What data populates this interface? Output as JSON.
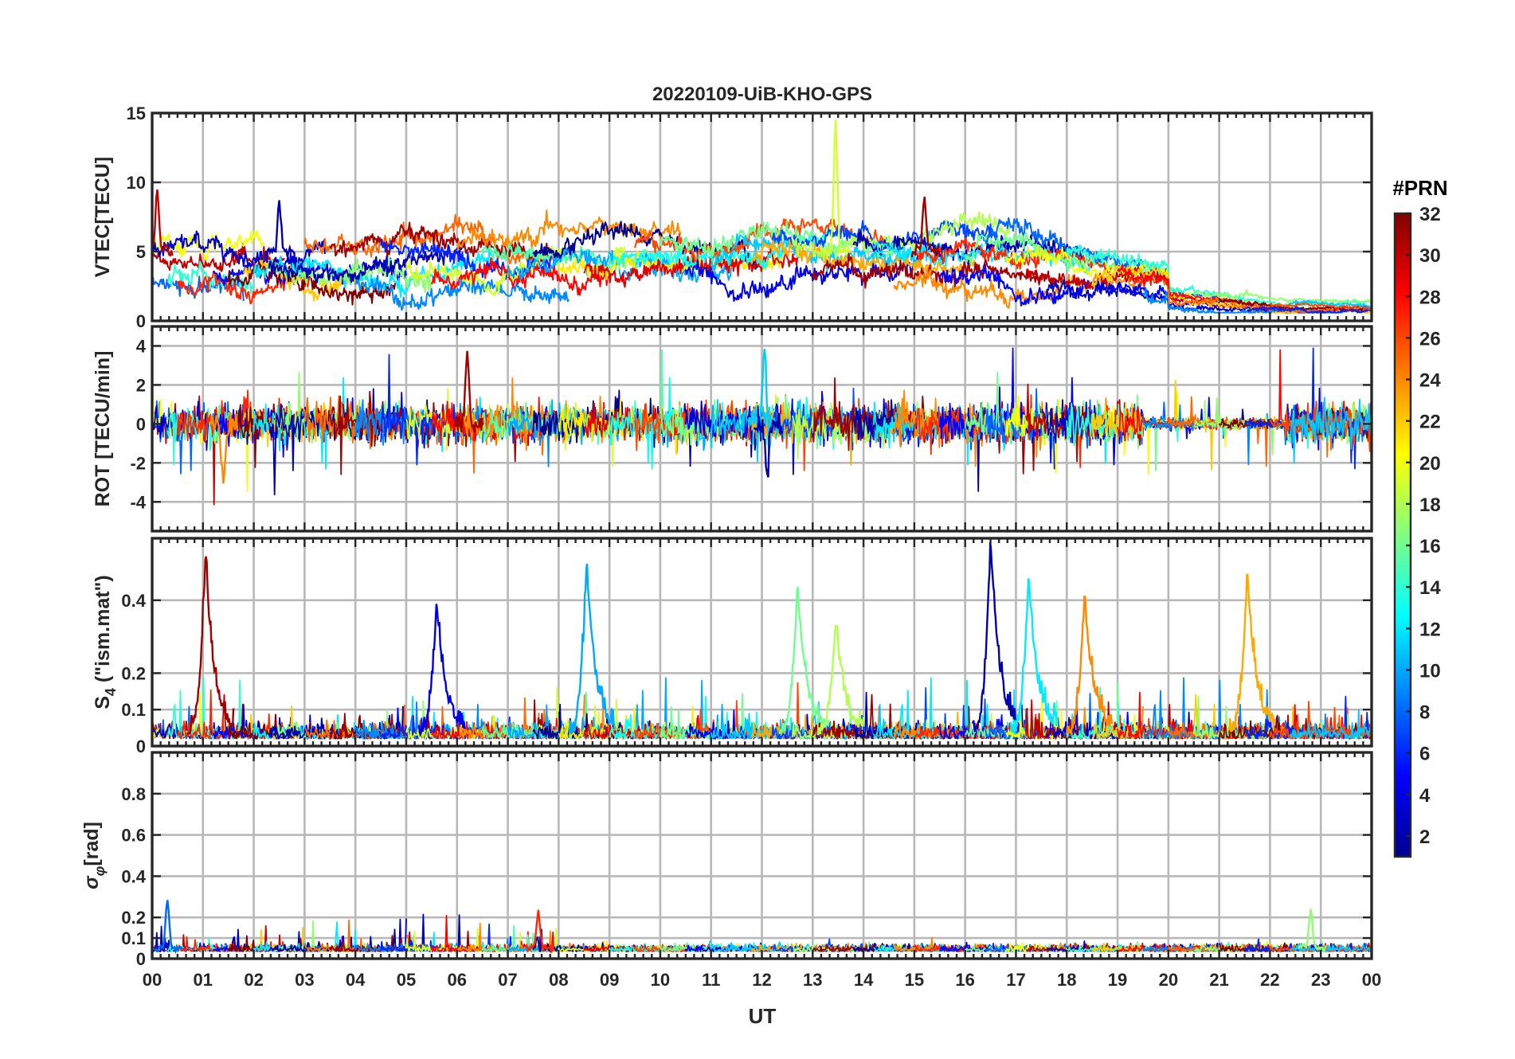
{
  "figure": {
    "title": "20220109-UiB-KHO-GPS",
    "xlabel": "UT"
  },
  "colorbar": {
    "title": "#PRN",
    "ticks": [
      "2",
      "4",
      "6",
      "8",
      "10",
      "12",
      "14",
      "16",
      "18",
      "20",
      "22",
      "24",
      "26",
      "28",
      "30",
      "32"
    ],
    "range": [
      1,
      32
    ],
    "colormap": "jet",
    "colors": [
      "#00008f",
      "#0000ff",
      "#0080ff",
      "#00ffff",
      "#80ff80",
      "#ffff00",
      "#ff8000",
      "#ff0000",
      "#800000"
    ]
  },
  "chart_data": [
    {
      "type": "line",
      "panel": "vtec",
      "ylabel": "VTEC[TECU]",
      "ylim": [
        0,
        15
      ],
      "yticks": [
        "0",
        "5",
        "10",
        "15"
      ],
      "xlim": [
        0,
        24
      ],
      "xticks": [
        "00",
        "01",
        "02",
        "03",
        "04",
        "05",
        "06",
        "07",
        "08",
        "09",
        "10",
        "11",
        "12",
        "13",
        "14",
        "15",
        "16",
        "17",
        "18",
        "19",
        "20",
        "21",
        "22",
        "23",
        "00"
      ],
      "grid": true,
      "series_description_values": {
        "typical_range": [
          1,
          8
        ],
        "peaks": [
          {
            "x": 13.45,
            "y": 14.2,
            "prn": 19
          },
          {
            "x": 15.2,
            "y": 8.9,
            "prn": 31
          },
          {
            "x": 0.1,
            "y": 9.2,
            "prn": 30
          },
          {
            "x": 2.5,
            "y": 8.6,
            "prn": 2
          }
        ]
      }
    },
    {
      "type": "line",
      "panel": "rot",
      "ylabel": "ROT [TECU/min]",
      "ylim": [
        -5.5,
        5
      ],
      "yticks": [
        "-4",
        "-2",
        "0",
        "2",
        "4"
      ],
      "xlim": [
        0,
        24
      ],
      "grid": true,
      "series_description_values": {
        "typical_range": [
          -1.5,
          1.5
        ],
        "peaks": [
          {
            "x": 12.05,
            "y": 3.8,
            "prn": 11
          },
          {
            "x": 12.1,
            "y": -2.8,
            "prn": 2
          },
          {
            "x": 6.2,
            "y": 3.4,
            "prn": 31
          },
          {
            "x": 1.4,
            "y": -3.2,
            "prn": 24
          }
        ]
      }
    },
    {
      "type": "line",
      "panel": "s4",
      "ylabel": "S",
      "ylabel_sub": "4",
      "ylabel_rest": " (\"ism.mat\")",
      "ylim": [
        0,
        0.57
      ],
      "yticks": [
        "0",
        "0.1",
        "0.2",
        "0.4"
      ],
      "xlim": [
        0,
        24
      ],
      "grid": true,
      "spikes": [
        {
          "x": 1.05,
          "peak": 0.52,
          "prn": 31
        },
        {
          "x": 5.6,
          "peak": 0.39,
          "prn": 4
        },
        {
          "x": 8.55,
          "peak": 0.5,
          "prn": 10
        },
        {
          "x": 12.7,
          "peak": 0.44,
          "prn": 16
        },
        {
          "x": 13.45,
          "peak": 0.33,
          "prn": 18
        },
        {
          "x": 16.5,
          "peak": 0.56,
          "prn": 2
        },
        {
          "x": 17.25,
          "peak": 0.46,
          "prn": 12
        },
        {
          "x": 18.35,
          "peak": 0.41,
          "prn": 24
        },
        {
          "x": 21.55,
          "peak": 0.47,
          "prn": 23
        }
      ]
    },
    {
      "type": "line",
      "panel": "sigma_phi",
      "ylabel": "σ",
      "ylabel_sub": "φ",
      "ylabel_rest": "[rad]",
      "ylim": [
        0,
        1
      ],
      "yticks": [
        "0",
        "0.1",
        "0.2",
        "0.4",
        "0.6",
        "0.8"
      ],
      "xlim": [
        0,
        24
      ],
      "grid": true,
      "series_description_values": {
        "typical_range": [
          0.02,
          0.1
        ],
        "peaks": [
          {
            "x": 0.3,
            "y": 0.28,
            "prn": 8
          },
          {
            "x": 7.6,
            "y": 0.22,
            "prn": 27
          },
          {
            "x": 22.8,
            "y": 0.23,
            "prn": 17
          }
        ]
      }
    }
  ]
}
